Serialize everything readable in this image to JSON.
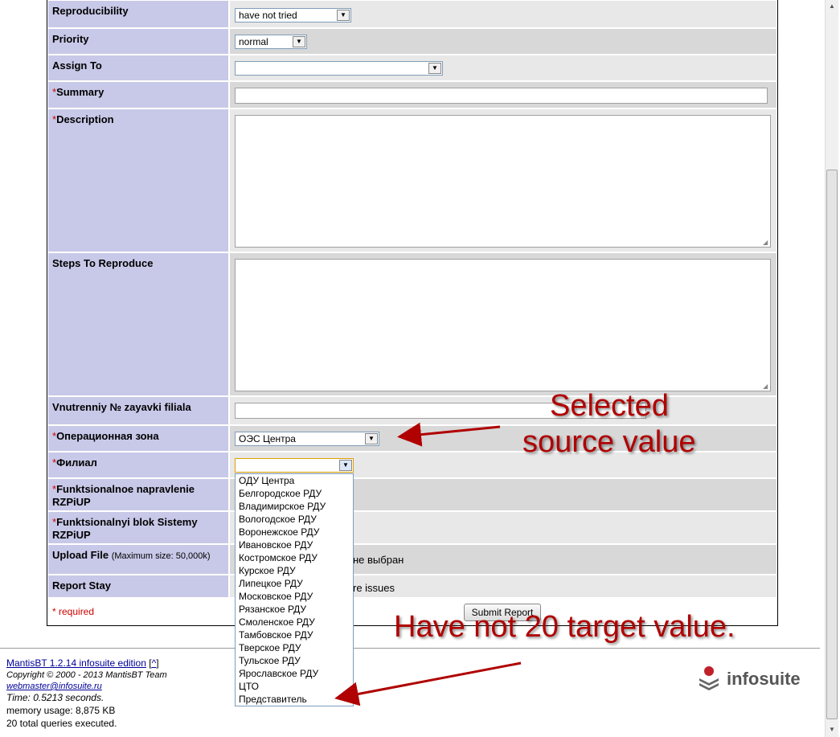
{
  "form": {
    "reproducibility": {
      "label": "Reproducibility",
      "value": "have not tried"
    },
    "priority": {
      "label": "Priority",
      "value": "normal"
    },
    "assign_to": {
      "label": "Assign To",
      "value": ""
    },
    "summary": {
      "star": "*",
      "label": "Summary",
      "value": ""
    },
    "description": {
      "star": "*",
      "label": "Description",
      "value": ""
    },
    "steps": {
      "label": "Steps To Reproduce",
      "value": ""
    },
    "internal_no": {
      "label": "Vnutrenniy № zayavki filiala",
      "value": ""
    },
    "op_zone": {
      "star": "*",
      "label": "Операционная зона",
      "value": "ОЭС Центра"
    },
    "filial": {
      "star": "*",
      "label": "Филиал",
      "value": ""
    },
    "func_dir": {
      "star": "*",
      "label": "Funktsionalnoe napravlenie RZPiUP"
    },
    "func_block": {
      "star": "*",
      "label": "Funktsionalnyi blok Sistemy RZPiUP"
    },
    "upload": {
      "label": "Upload File",
      "hint": "(Maximum size: 50,000k)",
      "status": "не выбран"
    },
    "report_stay": {
      "label": "Report Stay",
      "text": "re issues"
    },
    "required_note": "* required",
    "submit_label": "Submit Report"
  },
  "filial_options": [
    "ОДУ Центра",
    "Белгородское РДУ",
    "Владимирское РДУ",
    "Вологодское РДУ",
    "Воронежское РДУ",
    "Ивановское РДУ",
    "Костромское РДУ",
    "Курское РДУ",
    "Липецкое РДУ",
    "Московское РДУ",
    "Рязанское РДУ",
    "Смоленское РДУ",
    "Тамбовское РДУ",
    "Тверское РДУ",
    "Тульское РДУ",
    "Ярославское РДУ",
    "ЦТО",
    "Представитель"
  ],
  "annotations": {
    "selected_line1": "Selected",
    "selected_line2": "source value",
    "have_not": "Have not 20 target value."
  },
  "footer": {
    "mantis_link": "MantisBT 1.2.14 infosuite edition",
    "top_link_open": " [",
    "top_link": "^",
    "top_link_close": "]",
    "copyright": "Copyright © 2000 - 2013 MantisBT Team",
    "email": "webmaster@infosuite.ru",
    "time": "Time: 0.5213 seconds.",
    "memory": "memory usage: 8,875 KB",
    "queries": "20 total queries executed."
  },
  "logo": {
    "text": "infosuite"
  },
  "colors": {
    "label_bg": "#c8c8e8",
    "annotation": "#b00000",
    "required": "#cc0000"
  }
}
